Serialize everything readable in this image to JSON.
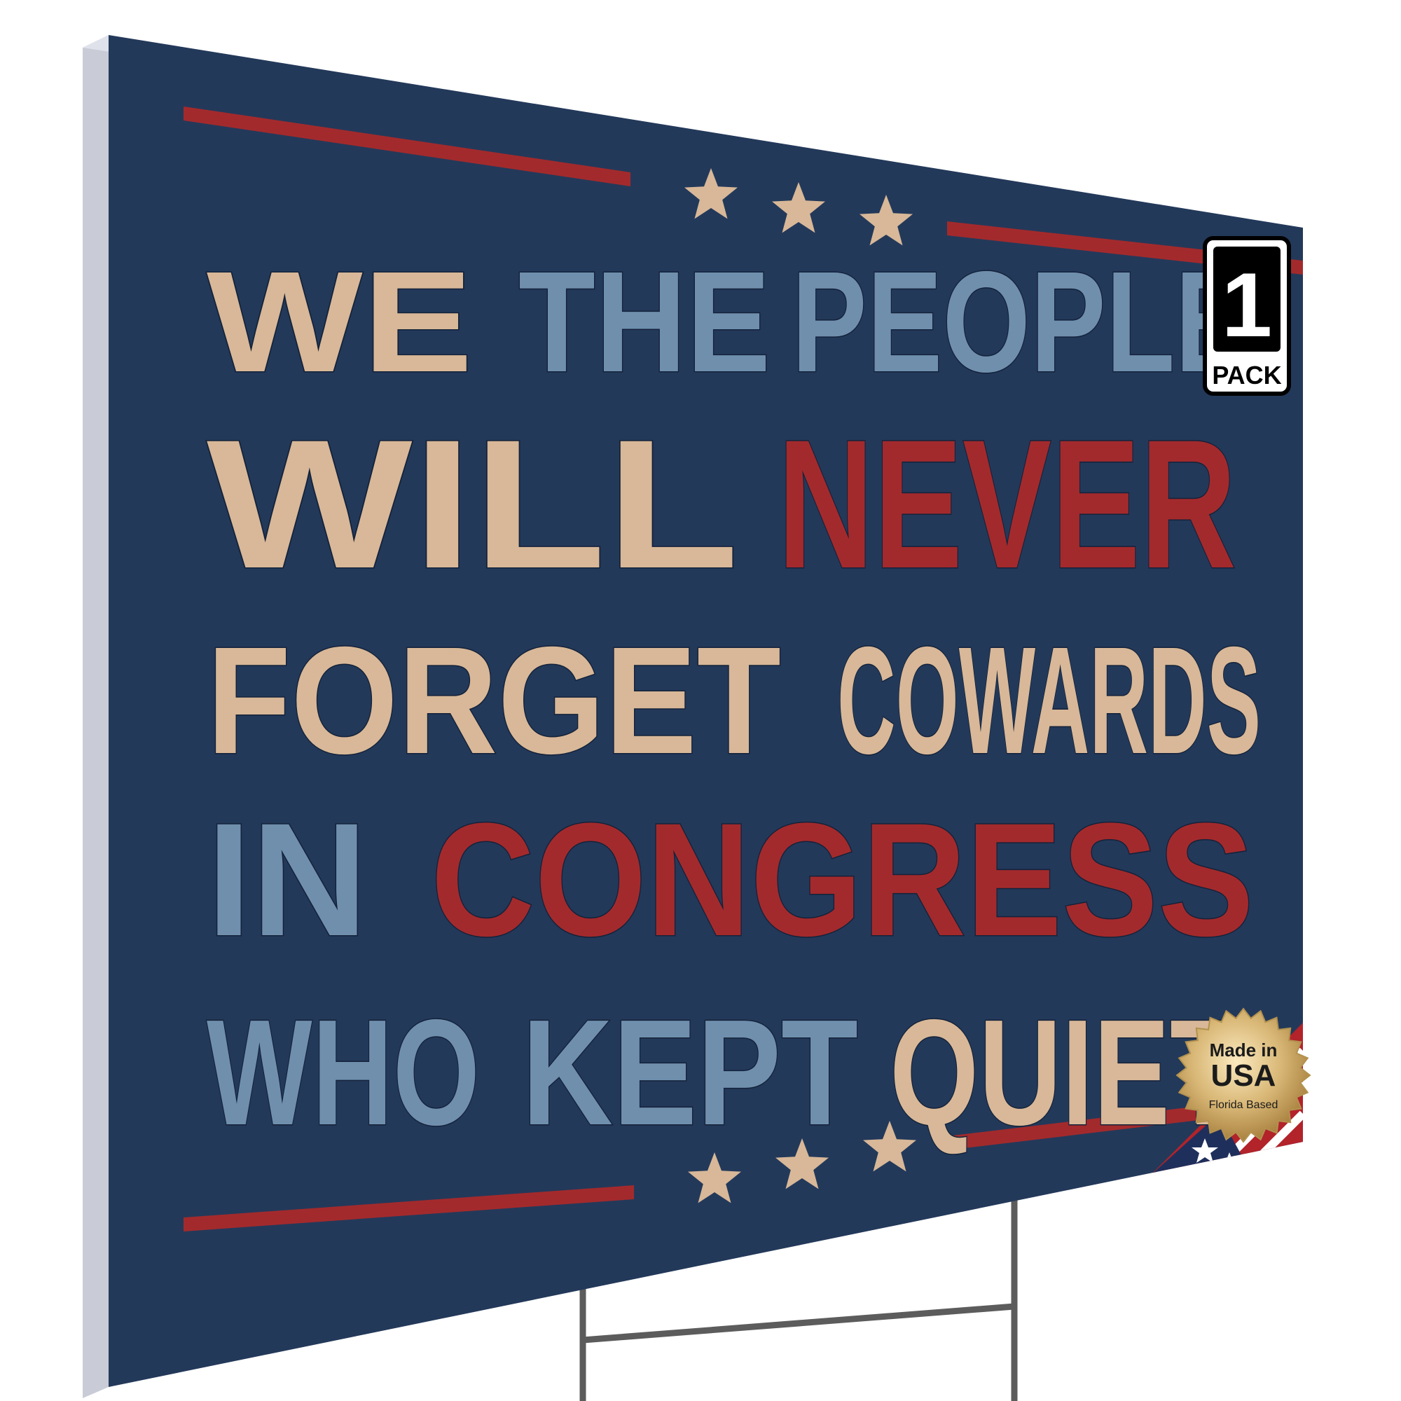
{
  "sign": {
    "lines": [
      {
        "words": [
          {
            "text": "WE",
            "color": "tan"
          },
          {
            "text": "THE",
            "color": "steel"
          },
          {
            "text": "PEOPLE",
            "color": "steel"
          }
        ]
      },
      {
        "words": [
          {
            "text": "WILL",
            "color": "tan"
          },
          {
            "text": "NEVER",
            "color": "red"
          }
        ]
      },
      {
        "words": [
          {
            "text": "FORGET",
            "color": "tan"
          },
          {
            "text": "COWARDS",
            "color": "tan"
          }
        ]
      },
      {
        "words": [
          {
            "text": "IN",
            "color": "steel"
          },
          {
            "text": "CONGRESS",
            "color": "red"
          }
        ]
      },
      {
        "words": [
          {
            "text": "WHO",
            "color": "steel"
          },
          {
            "text": "KEPT",
            "color": "steel"
          },
          {
            "text": "QUIET",
            "color": "tan"
          }
        ]
      }
    ],
    "star_rows": 2,
    "stars_per_row": 3
  },
  "pack_badge": {
    "number": "1",
    "label": "PACK"
  },
  "seal": {
    "line1": "Made in",
    "line2": "USA",
    "line3": "Florida Based"
  },
  "colors": {
    "navy": "#23395a",
    "tan": "#d8b898",
    "steel": "#6f8fad",
    "red": "#a32a2c",
    "stake": "#5c5c5c",
    "edge": "#c9ccd6",
    "gold": "#c9a660"
  }
}
